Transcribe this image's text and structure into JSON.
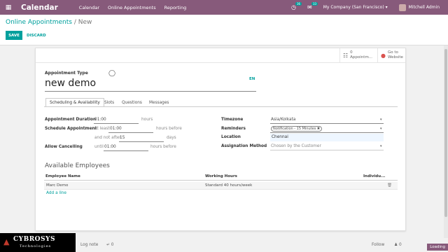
{
  "topbar": {
    "app_name": "Calendar",
    "menu": [
      "Calendar",
      "Online Appointments",
      "Reporting"
    ],
    "activity_count": "36",
    "message_count": "33",
    "company": "My Company (San Francisco)",
    "user": "Mitchell Admin"
  },
  "breadcrumb": {
    "parent": "Online Appointments",
    "separator": "/",
    "current": "New"
  },
  "buttons": {
    "save": "SAVE",
    "discard": "DISCARD"
  },
  "smart_buttons": [
    {
      "count": "0",
      "label": "Appointm...",
      "icon": "users-icon"
    },
    {
      "label1": "Go to",
      "label2": "Website",
      "icon": "globe-icon"
    }
  ],
  "form": {
    "type_label": "Appointment Type",
    "name": "new demo",
    "lang": "EN",
    "tabs": [
      "Scheduling & Availability",
      "Slots",
      "Questions",
      "Messages"
    ],
    "duration": {
      "label": "Appointment Duration",
      "value": "01:00",
      "unit": "hours"
    },
    "schedule": {
      "label": "Schedule Appointment",
      "prefix1": "at least",
      "value1": "01:00",
      "unit1": "hours before",
      "prefix2": "and not after",
      "value2": "15",
      "unit2": "days"
    },
    "cancel": {
      "label": "Allow Cancelling",
      "prefix": "until",
      "value": "01:00",
      "unit": "hours before"
    },
    "timezone": {
      "label": "Timezone",
      "value": "Asia/Kolkata"
    },
    "reminders": {
      "label": "Reminders",
      "tag": "Notification - 15 Minutes"
    },
    "location": {
      "label": "Location",
      "value": "Chennai"
    },
    "assignation": {
      "label": "Assignation Method",
      "value": "Chosen by the Customer"
    }
  },
  "employees": {
    "title": "Available Employees",
    "columns": [
      "Employee Name",
      "Working Hours",
      "Individu..."
    ],
    "rows": [
      {
        "name": "Marc Demo",
        "hours": "Standard 40 hours/week"
      }
    ],
    "add_line": "Add a line"
  },
  "chatter": {
    "log_note": "Log note",
    "attachments": "0",
    "follow": "Follow",
    "followers": "0"
  },
  "watermark": {
    "brand": "CYBROSYS",
    "sub": "Technologies"
  },
  "status": "Loading"
}
